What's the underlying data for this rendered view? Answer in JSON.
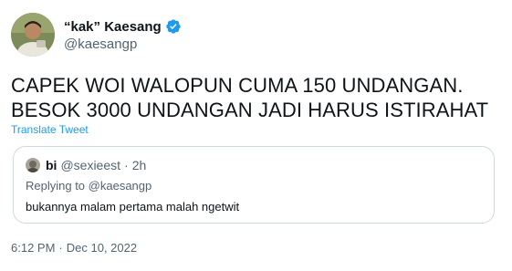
{
  "author": {
    "name": "“kak” Kaesang",
    "handle": "@kaesangp",
    "verified": true,
    "verified_color": "#1d9bf0"
  },
  "tweet": {
    "lines": [
      "CAPEK WOI WALOPUN CUMA 150 UNDANGAN.",
      "BESOK 3000 UNDANGAN JADI HARUS ISTIRAHAT"
    ],
    "translate_label": "Translate Tweet"
  },
  "quoted_tweet": {
    "name": "bi",
    "handle": "@sexieest",
    "separator": "·",
    "time": "2h",
    "replying_prefix": "Replying to",
    "replying_to": "@kaesangp",
    "text": "bukannya malam pertama malah ngetwit"
  },
  "meta": {
    "time": "6:12 PM",
    "separator": "·",
    "date": "Dec 10, 2022"
  },
  "colors": {
    "link": "#1d9bf0",
    "secondary_text": "#536471",
    "border": "#cfd9de"
  }
}
